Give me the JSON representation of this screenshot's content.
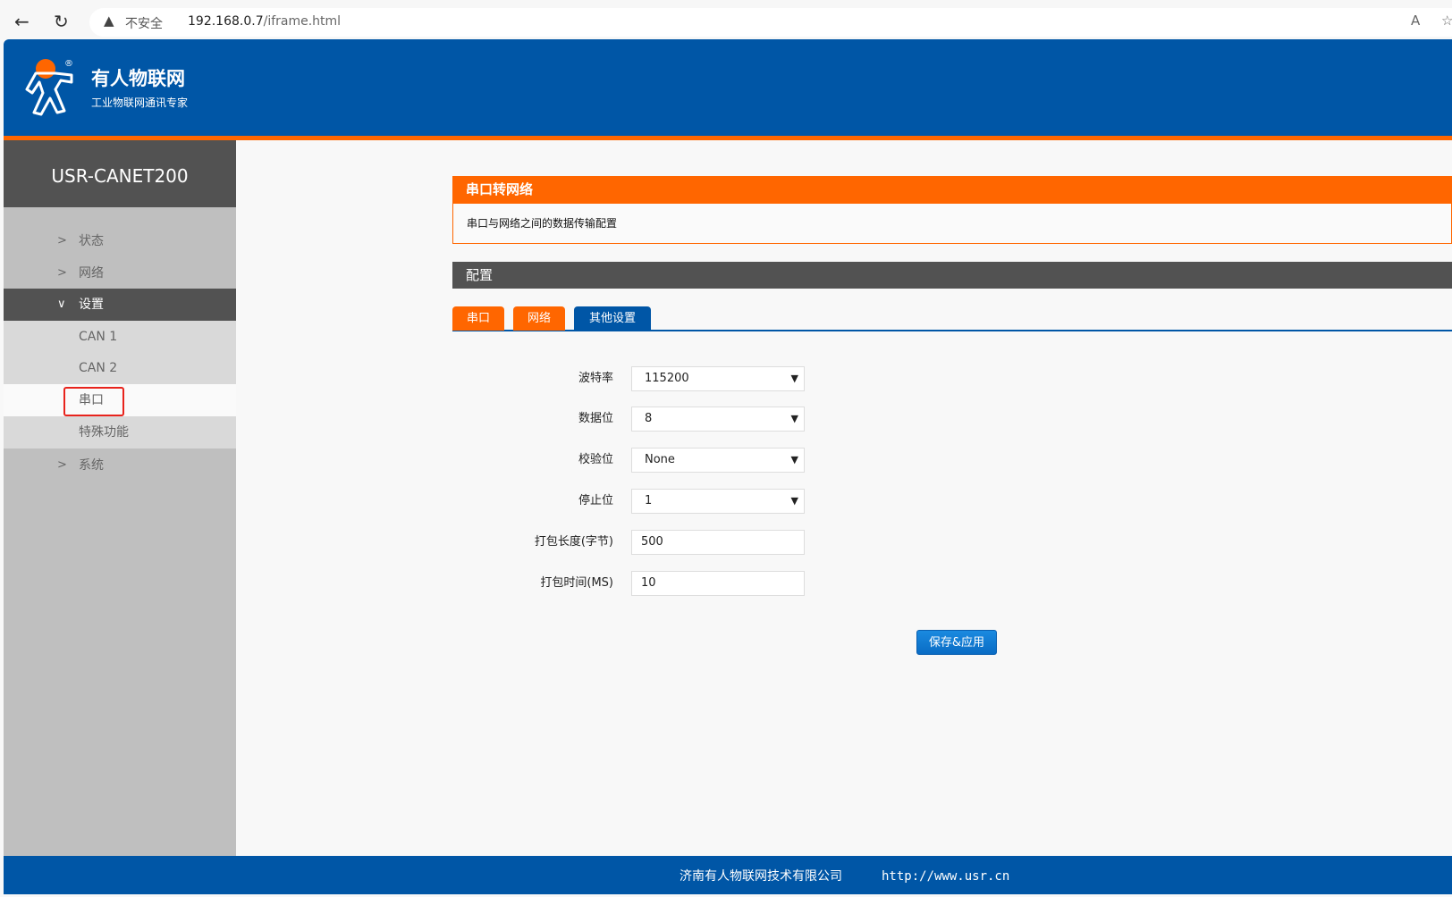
{
  "browser": {
    "security_label": "不安全",
    "url_host": "192.168.0.7",
    "url_path": "/iframe.html"
  },
  "header": {
    "brand": "有人物联网",
    "slogan": "工业物联网通讯专家",
    "logo_mark": "®"
  },
  "sidebar": {
    "title": "USR-CANET200",
    "items": [
      {
        "label": "状态"
      },
      {
        "label": "网络"
      },
      {
        "label": "设置"
      },
      {
        "label": "CAN 1"
      },
      {
        "label": "CAN 2"
      },
      {
        "label": "串口"
      },
      {
        "label": "特殊功能"
      },
      {
        "label": "系统"
      }
    ]
  },
  "panel": {
    "title": "串口转网络",
    "description": "串口与网络之间的数据传输配置",
    "config_title": "配置"
  },
  "tabs": [
    {
      "label": "串口"
    },
    {
      "label": "网络"
    },
    {
      "label": "其他设置"
    }
  ],
  "form": {
    "fields": [
      {
        "label": "波特率",
        "value": "115200"
      },
      {
        "label": "数据位",
        "value": "8"
      },
      {
        "label": "校验位",
        "value": "None"
      },
      {
        "label": "停止位",
        "value": "1"
      },
      {
        "label": "打包长度(字节)",
        "value": "500"
      },
      {
        "label": "打包时间(MS)",
        "value": "10"
      }
    ],
    "save_label": "保存&应用"
  },
  "footer": {
    "company": "济南有人物联网技术有限公司",
    "website": "http://www.usr.cn"
  },
  "colors": {
    "brand_blue": "#0056a6",
    "accent_orange": "#ff6600",
    "dark_gray": "#525252"
  }
}
